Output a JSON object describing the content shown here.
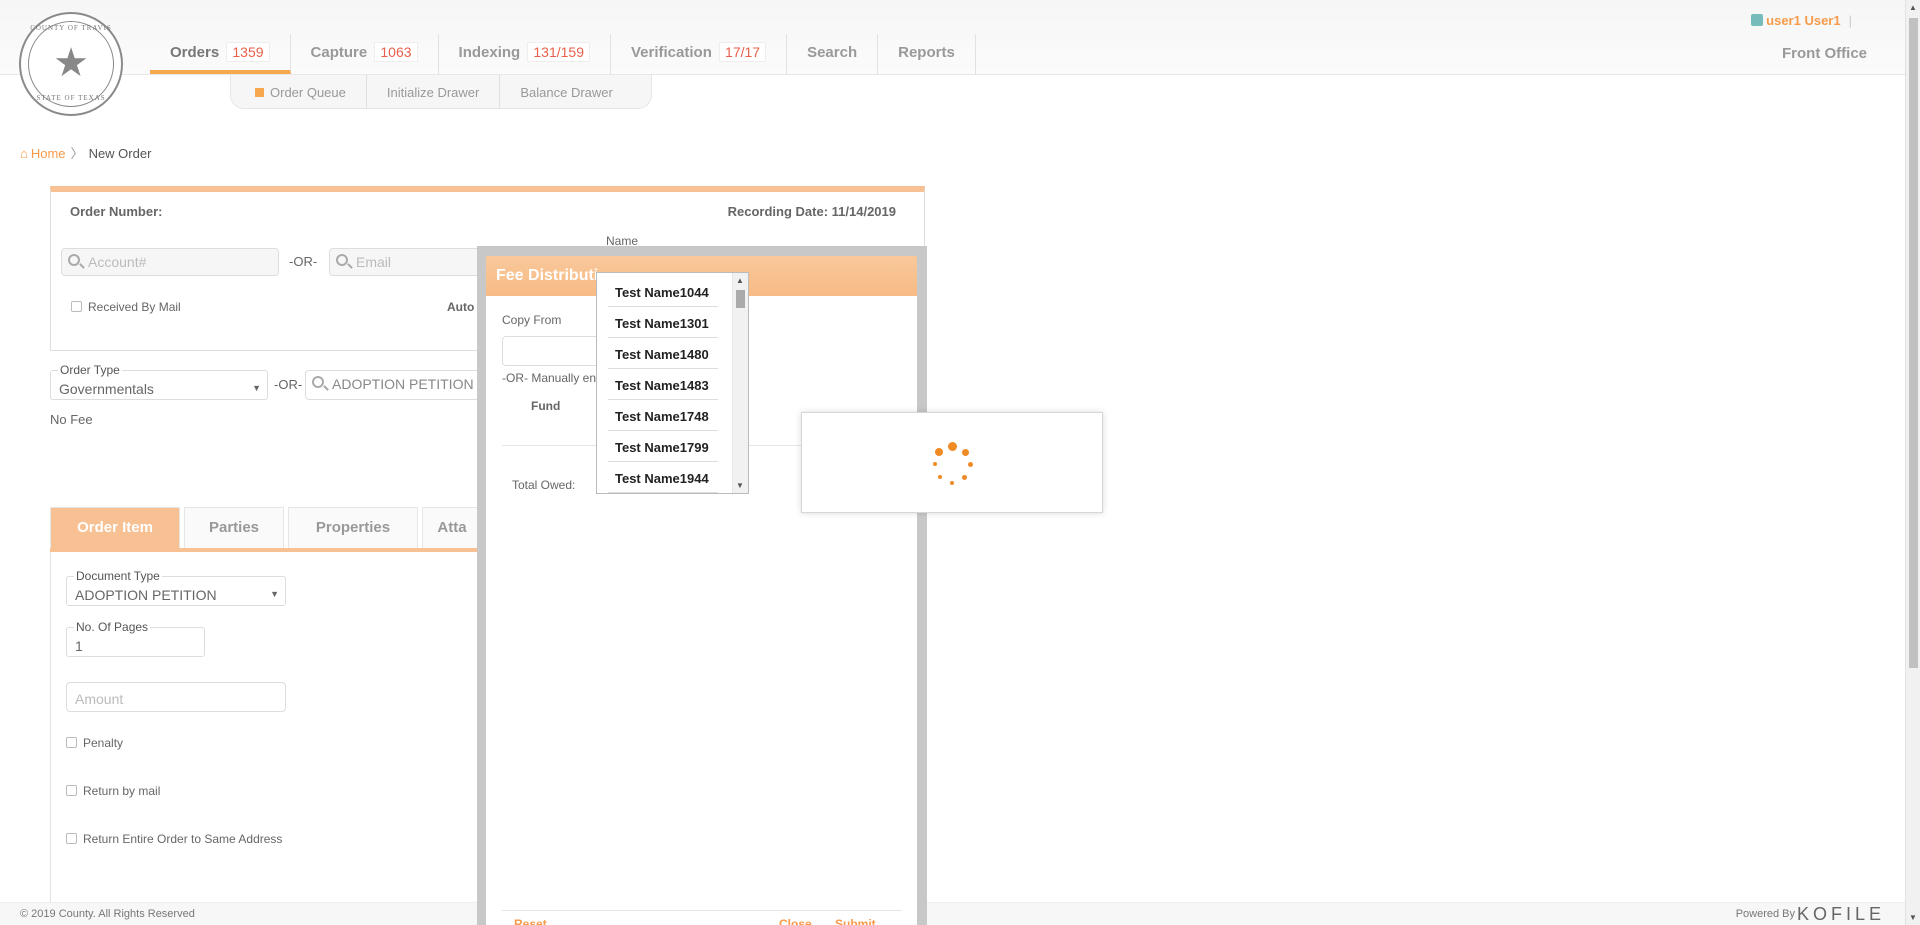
{
  "header": {
    "logo_text_top": "COUNTY OF TRAVIS",
    "logo_text_bottom": "STATE OF TEXAS",
    "nav": [
      {
        "label": "Orders",
        "count": "1359"
      },
      {
        "label": "Capture",
        "count": "1063"
      },
      {
        "label": "Indexing",
        "count": "131/159"
      },
      {
        "label": "Verification",
        "count": "17/17"
      },
      {
        "label": "Search"
      },
      {
        "label": "Reports"
      }
    ],
    "front_office": "Front Office",
    "user": "user1 User1"
  },
  "subnav": [
    "Order Queue",
    "Initialize Drawer",
    "Balance Drawer"
  ],
  "breadcrumb": {
    "home": "Home",
    "current": "New Order"
  },
  "order": {
    "order_number_label": "Order Number:",
    "recording_date_label": "Recording Date: 11/14/2019",
    "account_placeholder": "Account#",
    "or": "-OR-",
    "email_placeholder": "Email",
    "name_legend": "Name",
    "received_by_mail": "Received By Mail",
    "auto_label": "Auto"
  },
  "order_type": {
    "legend": "Order Type",
    "value": "Governmentals",
    "or": "-OR-",
    "search_value": "ADOPTION PETITION",
    "fee_text": "No Fee"
  },
  "tabs": [
    "Order Item",
    "Parties",
    "Properties",
    "Atta"
  ],
  "item": {
    "doc_type_legend": "Document Type",
    "doc_type_value": "ADOPTION PETITION",
    "pages_legend": "No. Of Pages",
    "pages_value": "1",
    "amount_placeholder": "Amount",
    "penalty": "Penalty",
    "return_by_mail": "Return by mail",
    "return_entire": "Return Entire Order to Same Address"
  },
  "dialog": {
    "title": "Fee Distributi",
    "copy_from": "Copy From",
    "manually": "-OR- Manually en",
    "fund": "Fund",
    "total_owed": "Total Owed:",
    "reset": "Reset",
    "close": "Close",
    "submit": "Submit"
  },
  "dropdown_items": [
    "Test Name1044",
    "Test Name1301",
    "Test Name1480",
    "Test Name1483",
    "Test Name1748",
    "Test Name1799",
    "Test Name1944"
  ],
  "footer": {
    "copyright": "© 2019 County. All Rights Reserved",
    "powered": "Powered By",
    "brand": "KOFILE"
  },
  "colors": {
    "accent": "#f7a84f",
    "count": "#e8604c",
    "spinner": "#f08a24"
  }
}
